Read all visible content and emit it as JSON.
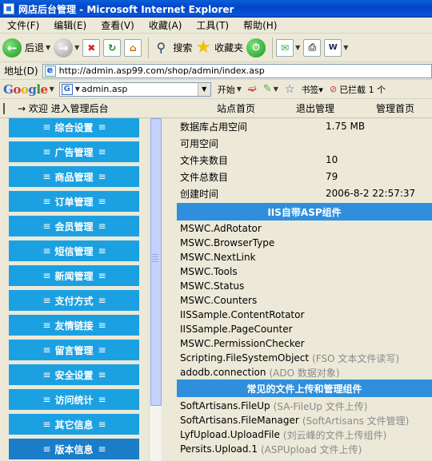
{
  "window": {
    "title": "网店后台管理 - Microsoft Internet Explorer"
  },
  "menu": [
    "文件(F)",
    "编辑(E)",
    "查看(V)",
    "收藏(A)",
    "工具(T)",
    "帮助(H)"
  ],
  "toolbar": {
    "back": "后退",
    "search": "搜索",
    "favorites": "收藏夹"
  },
  "address": {
    "label": "地址(D)",
    "url": "http://admin.asp99.com/shop/admin/index.asp"
  },
  "google": {
    "logo": "Google",
    "query": "admin.asp",
    "start": "开始",
    "bookmarks": "书签▾",
    "blocked": "已拦截 1 个"
  },
  "admin_nav": {
    "welcome": "→ 欢迎  进入管理后台",
    "site_home": "站点首页",
    "logout": "退出管理",
    "admin_home": "管理首页"
  },
  "sidebar": {
    "items": [
      "综合设置",
      "广告管理",
      "商品管理",
      "订单管理",
      "会员管理",
      "短信管理",
      "新闻管理",
      "支付方式",
      "友情链接",
      "留言管理",
      "安全设置",
      "访问统计",
      "其它信息",
      "版本信息"
    ]
  },
  "stats": [
    {
      "label": "数据库占用空间",
      "value": "1.75 MB"
    },
    {
      "label": "可用空间",
      "value": ""
    },
    {
      "label": "文件夹数目",
      "value": "10"
    },
    {
      "label": "文件总数目",
      "value": "79"
    },
    {
      "label": "创建时间",
      "value": "2006-8-2 22:57:37"
    }
  ],
  "sections": {
    "iis": "IIS自带ASP组件",
    "upload": "常见的文件上传和管理组件"
  },
  "iis_components": [
    {
      "name": "MSWC.AdRotator",
      "note": ""
    },
    {
      "name": "MSWC.BrowserType",
      "note": ""
    },
    {
      "name": "MSWC.NextLink",
      "note": ""
    },
    {
      "name": "MSWC.Tools",
      "note": ""
    },
    {
      "name": "MSWC.Status",
      "note": ""
    },
    {
      "name": "MSWC.Counters",
      "note": ""
    },
    {
      "name": "IISSample.ContentRotator",
      "note": ""
    },
    {
      "name": "IISSample.PageCounter",
      "note": ""
    },
    {
      "name": "MSWC.PermissionChecker",
      "note": ""
    },
    {
      "name": "Scripting.FileSystemObject",
      "note": "(FSO 文本文件读写)"
    },
    {
      "name": "adodb.connection",
      "note": "(ADO 数据对象)"
    }
  ],
  "upload_components": [
    {
      "name": "SoftArtisans.FileUp",
      "note": "(SA-FileUp 文件上传)"
    },
    {
      "name": "SoftArtisans.FileManager",
      "note": "(SoftArtisans 文件管理)"
    },
    {
      "name": "LyfUpload.UploadFile",
      "note": "(刘云峰的文件上传组件)"
    },
    {
      "name": "Persits.Upload.1",
      "note": "(ASPUpload 文件上传)"
    }
  ]
}
